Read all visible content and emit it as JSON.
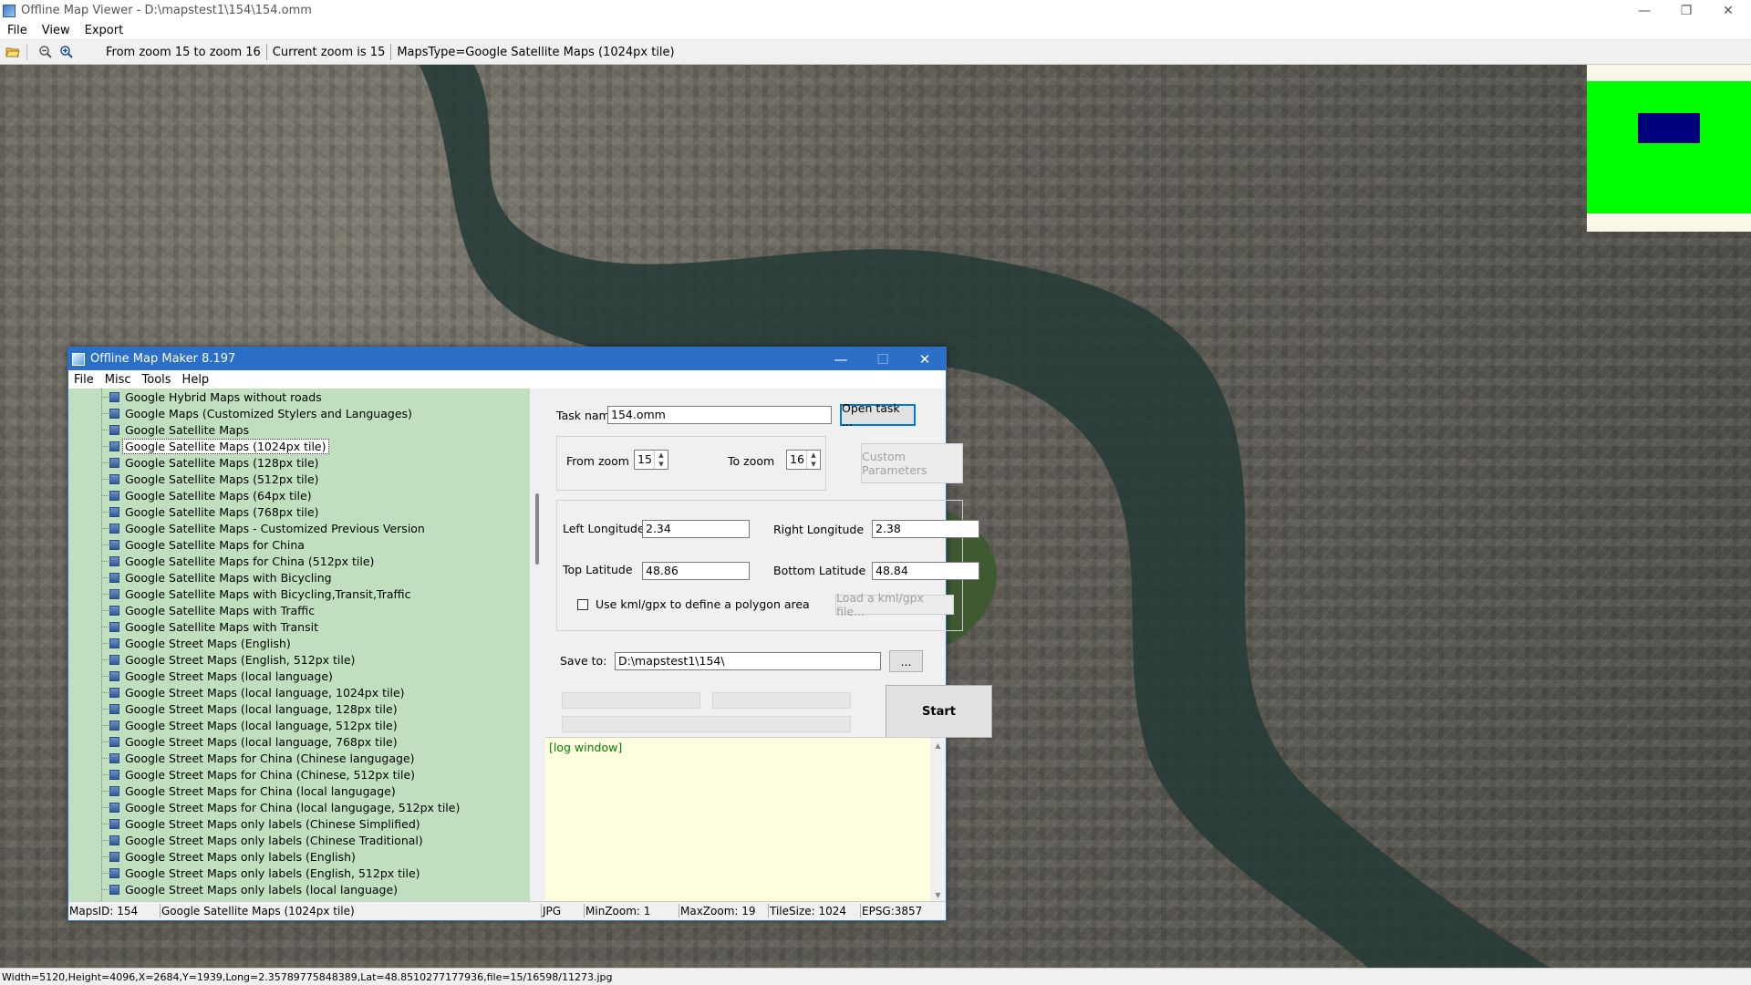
{
  "app": {
    "title": "Offline Map Viewer - D:\\mapstest1\\154\\154.omm",
    "window_controls": {
      "minimize": "—",
      "maximize": "❐",
      "close": "✕"
    }
  },
  "menu": [
    "File",
    "View",
    "Export"
  ],
  "toolbar": {
    "icons": [
      "folder-open-icon",
      "zoom-out-icon",
      "zoom-in-icon"
    ],
    "zoom_range": "From zoom 15 to zoom 16",
    "current_zoom": "Current zoom is 15",
    "maps_type": "MapsType=Google Satellite Maps (1024px tile)"
  },
  "statusbar": {
    "text": "Width=5120,Height=4096,X=2684,Y=1939,Long=2.35789775848389,Lat=48.8510277177936,file=15/16598/11273.jpg"
  },
  "dialog": {
    "title": "Offline Map Maker 8.197",
    "window_controls": {
      "minimize": "—",
      "maximize": "☐",
      "close": "✕"
    },
    "menu": [
      "File",
      "Misc",
      "Tools",
      "Help"
    ],
    "maps_list": [
      "Google Hybrid Maps without roads",
      "Google Maps (Customized Stylers and Languages)",
      "Google Satellite Maps",
      "Google Satellite Maps (1024px tile)",
      "Google Satellite Maps (128px tile)",
      "Google Satellite Maps (512px tile)",
      "Google Satellite Maps (64px tile)",
      "Google Satellite Maps (768px tile)",
      "Google Satellite Maps - Customized Previous Version",
      "Google Satellite Maps for China",
      "Google Satellite Maps for China (512px tile)",
      "Google Satellite Maps with Bicycling",
      "Google Satellite Maps with Bicycling,Transit,Traffic",
      "Google Satellite Maps with Traffic",
      "Google Satellite Maps with Transit",
      "Google Street Maps (English)",
      "Google Street Maps (English, 512px tile)",
      "Google Street Maps (local language)",
      "Google Street Maps (local language, 1024px tile)",
      "Google Street Maps (local language, 128px tile)",
      "Google Street Maps (local language, 512px tile)",
      "Google Street Maps (local language, 768px tile)",
      "Google Street Maps for China (Chinese langugage)",
      "Google Street Maps for China (Chinese, 512px tile)",
      "Google Street Maps for China (local langugage)",
      "Google Street Maps for China (local langugage, 512px tile)",
      "Google Street Maps only labels (Chinese Simplified)",
      "Google Street Maps only labels (Chinese Traditional)",
      "Google Street Maps only labels (English)",
      "Google Street Maps only labels (English, 512px tile)",
      "Google Street Maps only labels (local language)"
    ],
    "selected_index": 3,
    "task_name_label": "Task name",
    "task_name_value": "154.omm",
    "open_task_button": "Open task ...",
    "from_zoom_label": "From zoom",
    "from_zoom_value": "15",
    "to_zoom_label": "To zoom",
    "to_zoom_value": "16",
    "custom_parameters_button": "Custom Parameters",
    "left_longitude_label": "Left Longitude",
    "left_longitude_value": "2.34",
    "right_longitude_label": "Right Longitude",
    "right_longitude_value": "2.38",
    "top_latitude_label": "Top Latitude",
    "top_latitude_value": "48.86",
    "bottom_latitude_label": "Bottom Latitude",
    "bottom_latitude_value": "48.84",
    "use_kml_label": "Use kml/gpx to define a polygon area",
    "use_kml_checked": false,
    "load_kml_button": "Load a kml/gpx file...",
    "save_to_label": "Save to:",
    "save_to_value": "D:\\mapstest1\\154\\",
    "browse_button": "...",
    "start_button": "Start",
    "log_text": "[log window]",
    "status": {
      "maps_id": "MapsID: 154",
      "maps_name": "Google Satellite Maps (1024px tile)",
      "format": "JPG",
      "min_zoom": "MinZoom: 1",
      "max_zoom": "MaxZoom: 19",
      "tile_size": "TileSize: 1024",
      "epsg": "EPSG:3857"
    }
  },
  "colors": {
    "dialog_title": "#2b6fc7",
    "tree_bg": "#bfdfbf",
    "log_bg": "#ffffe0",
    "overview_green": "#00ff00",
    "overview_blue": "#00007f"
  }
}
